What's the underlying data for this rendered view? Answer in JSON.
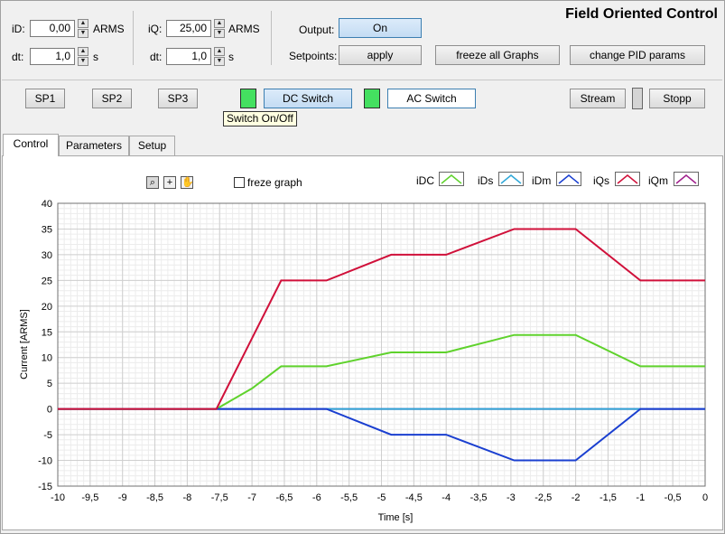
{
  "app_title": "Field Oriented Control",
  "inputs": {
    "id": {
      "label": "iD:",
      "value": "0,00",
      "unit": "ARMS"
    },
    "iq": {
      "label": "iQ:",
      "value": "25,00",
      "unit": "ARMS"
    },
    "dt1": {
      "label": "dt:",
      "value": "1,0",
      "unit": "s"
    },
    "dt2": {
      "label": "dt:",
      "value": "1,0",
      "unit": "s"
    }
  },
  "output": {
    "label": "Output:",
    "button": "On"
  },
  "setpoints": {
    "label": "Setpoints:",
    "apply": "apply"
  },
  "buttons": {
    "freeze_all": "freeze all Graphs",
    "change_pid": "change PID params",
    "sp1": "SP1",
    "sp2": "SP2",
    "sp3": "SP3",
    "dc_switch": "DC Switch",
    "ac_switch": "AC Switch",
    "stream": "Stream",
    "stopp": "Stopp"
  },
  "tooltip": "Switch On/Off",
  "tabs": [
    "Control",
    "Parameters",
    "Setup"
  ],
  "graph": {
    "freeze_label": "freze graph"
  },
  "colors": {
    "iDC": "#5fd22c",
    "iDs": "#30a8d8",
    "iDm": "#1a3fd0",
    "iQs": "#d0103a",
    "iQm": "#a0208c",
    "led": "#44e060"
  },
  "chart_data": {
    "type": "line",
    "xlabel": "Time [s]",
    "ylabel": "Current [ARMS]",
    "xlim": [
      -10,
      0
    ],
    "ylim": [
      -15,
      40
    ],
    "x_ticks": [
      "-10",
      "-9,5",
      "-9",
      "-8,5",
      "-8",
      "-7,5",
      "-7",
      "-6,5",
      "-6",
      "-5,5",
      "-5",
      "-4,5",
      "-4",
      "-3,5",
      "-3",
      "-2,5",
      "-2",
      "-1,5",
      "-1",
      "-0,5",
      "0"
    ],
    "y_ticks": [
      "40",
      "35",
      "30",
      "25",
      "20",
      "15",
      "10",
      "5",
      "0",
      "-5",
      "-10",
      "-15"
    ],
    "grid": true,
    "legend_position": "top-right",
    "series": [
      {
        "name": "iDC",
        "x": [
          -10,
          -7.55,
          -7,
          -6.55,
          -5.85,
          -4.85,
          -4,
          -2.95,
          -2,
          -1,
          0
        ],
        "y": [
          0,
          0,
          4,
          8.3,
          8.3,
          11,
          11,
          14.4,
          14.4,
          8.3,
          8.3
        ]
      },
      {
        "name": "iDs",
        "x": [
          -10,
          0
        ],
        "y": [
          0,
          0
        ]
      },
      {
        "name": "iDm",
        "x": [
          -10,
          -7.55,
          -5.85,
          -4.85,
          -4,
          -2.95,
          -2,
          -1,
          0
        ],
        "y": [
          0,
          0,
          0,
          -5,
          -5,
          -10,
          -10,
          0,
          0
        ]
      },
      {
        "name": "iQs",
        "x": [
          -10,
          -7.55,
          -6.55,
          -5.85,
          -4.85,
          -4,
          -2.95,
          -2,
          -1,
          0
        ],
        "y": [
          0,
          0,
          25,
          25,
          30,
          30,
          35,
          35,
          25,
          25
        ]
      },
      {
        "name": "iQm",
        "x": [
          -10,
          0
        ],
        "y": [
          0,
          0
        ]
      }
    ]
  }
}
